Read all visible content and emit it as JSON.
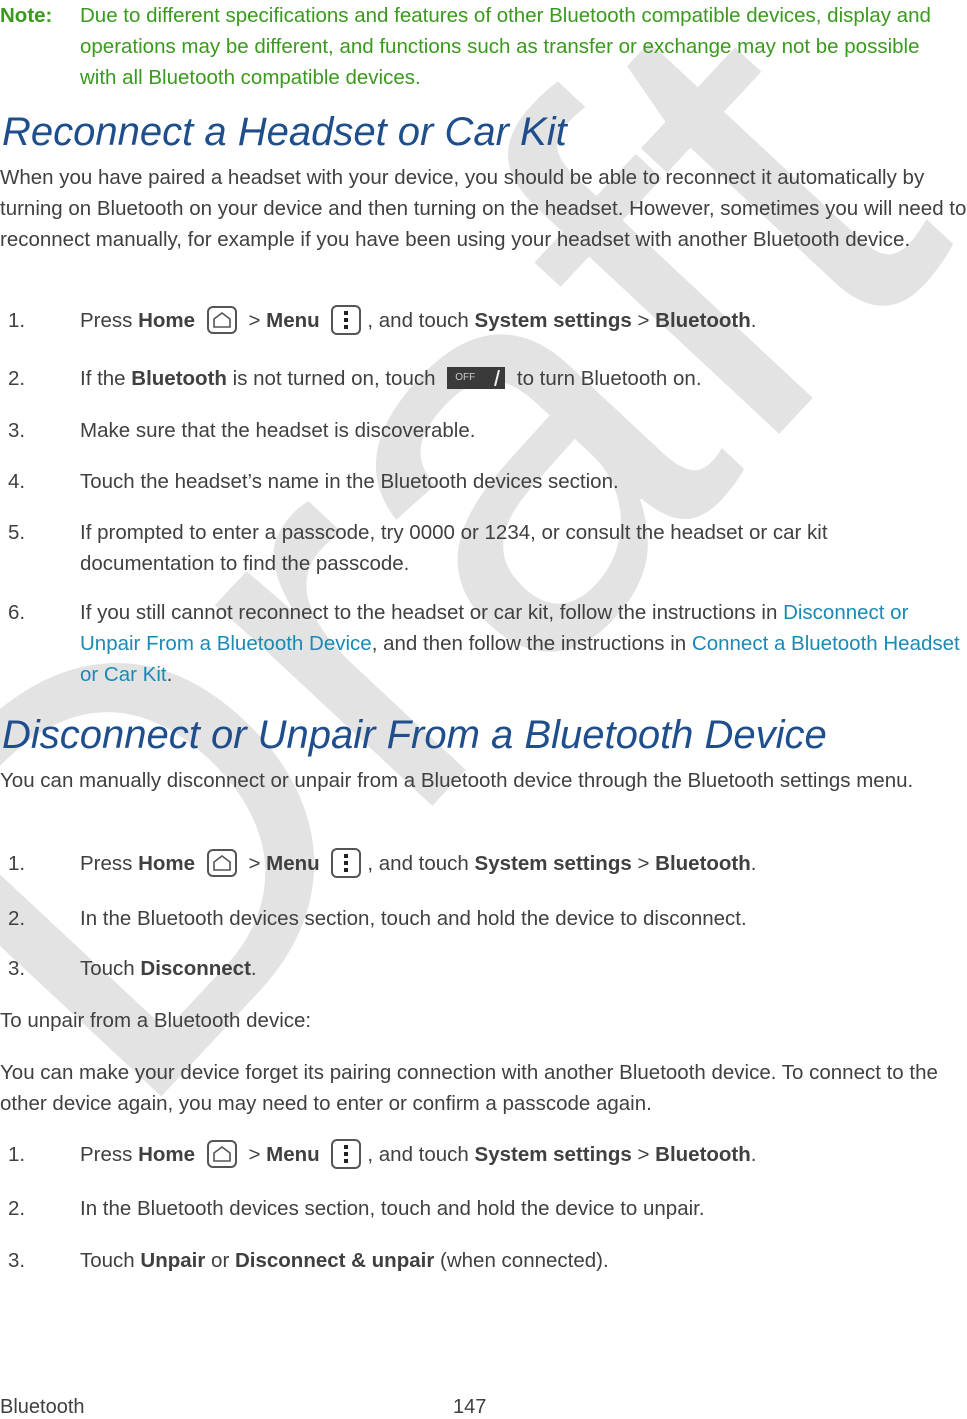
{
  "note": {
    "label": "Note:",
    "text": "Due to different specifications and features of other Bluetooth compatible devices, display and operations may be different, and functions such as transfer or exchange may not be possible with all Bluetooth compatible devices."
  },
  "section1": {
    "title": "Reconnect a Headset or Car Kit",
    "intro": "When you have paired a headset with your device, you should be able to reconnect it automatically by turning on Bluetooth on your device and then turning on the headset. However, sometimes you will need to reconnect manually, for example if you have been using your headset with another Bluetooth device.",
    "steps": [
      {
        "num": "1.",
        "press": "Press ",
        "home": "Home",
        "gt1": " > ",
        "menu": "Menu",
        "mid": ", and touch ",
        "sys": "System settings",
        "gt2": " > ",
        "bt": "Bluetooth",
        "end": "."
      },
      {
        "num": "2.",
        "pre": "If the ",
        "bold": "Bluetooth",
        "mid": " is not turned on, touch ",
        "icon_label": "OFF",
        "post": " to turn Bluetooth on."
      },
      {
        "num": "3.",
        "text": "Make sure that the headset is discoverable."
      },
      {
        "num": "4.",
        "text": "Touch the headset’s name in the Bluetooth devices section."
      },
      {
        "num": "5.",
        "text": "If prompted to enter a passcode, try 0000 or 1234, or consult the headset or car kit documentation to find the passcode."
      },
      {
        "num": "6.",
        "pre": "If you still cannot reconnect to the headset or car kit, follow the instructions in ",
        "link1": "Disconnect or Unpair From a Bluetooth Device",
        "mid": ", and then follow the instructions in ",
        "link2": "Connect a Bluetooth Headset or Car Kit",
        "end": "."
      }
    ]
  },
  "section2": {
    "title": "Disconnect or Unpair From a Bluetooth Device",
    "intro": "You can manually disconnect or unpair from a Bluetooth device through the Bluetooth settings menu.",
    "steps_a": [
      {
        "num": "1.",
        "press": "Press ",
        "home": "Home",
        "gt1": " > ",
        "menu": "Menu",
        "mid": ", and touch ",
        "sys": "System settings",
        "gt2": " > ",
        "bt": "Bluetooth",
        "end": "."
      },
      {
        "num": "2.",
        "text": "In the Bluetooth devices section, touch and hold the device to disconnect."
      },
      {
        "num": "3.",
        "pre": "Touch ",
        "bold": "Disconnect",
        "end": "."
      }
    ],
    "unpair_heading": "To unpair from a Bluetooth device:",
    "unpair_intro": "You can make your device forget its pairing connection with another Bluetooth device. To connect to the other device again, you may need to enter or confirm a passcode again.",
    "steps_b": [
      {
        "num": "1.",
        "press": "Press ",
        "home": "Home",
        "gt1": " > ",
        "menu": "Menu",
        "mid": ", and touch ",
        "sys": "System settings",
        "gt2": " > ",
        "bt": "Bluetooth",
        "end": "."
      },
      {
        "num": "2.",
        "text": "In the Bluetooth devices section, touch and hold the device to unpair."
      },
      {
        "num": "3.",
        "pre": "Touch ",
        "bold1": "Unpair",
        "or": " or ",
        "bold2": "Disconnect & unpair",
        "end": " (when connected)."
      }
    ]
  },
  "watermark": "Draft",
  "footer": {
    "section": "Bluetooth",
    "page": "147"
  }
}
